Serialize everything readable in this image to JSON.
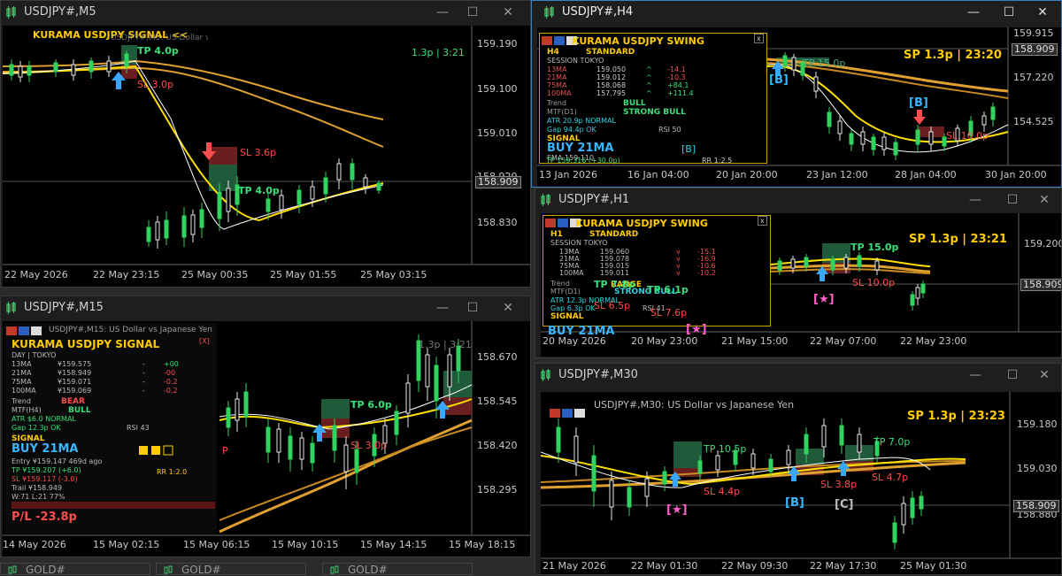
{
  "windows": {
    "m5": {
      "title": "USDJPY#,M5"
    },
    "m15": {
      "title": "USDJPY#,M15"
    },
    "h4": {
      "title": "USDJPY#,H4"
    },
    "h1": {
      "title": "USDJPY#,H1"
    },
    "m30": {
      "title": "USDJPY#,M30"
    }
  },
  "controls": {
    "minimize": "—",
    "maximize": "☐",
    "close": "✕"
  },
  "m5": {
    "header": "KURAMA USDJPY SIGNAL <<",
    "subheader": "USDJPY#,M5: US Dollar vs Japanese Yen",
    "spread": "1.3p | 3:21",
    "prices": [
      "159.190",
      "159.100",
      "159.010",
      "158.920",
      "158.830"
    ],
    "current": "158.909",
    "times": [
      "22 May 2026",
      "22 May 23:15",
      "25 May 00:35",
      "25 May 01:55",
      "25 May 03:15"
    ],
    "labels": {
      "tp1": "TP 4.0p",
      "sl1": "SL 3.0p",
      "sl2": "SL 3.6p",
      "tp2": "TP 4.0p"
    }
  },
  "m15": {
    "header": "KURAMA USDJPY SIGNAL",
    "subheader": "USDJPY#,M15: US Dollar vs Japanese Yen",
    "close_x": "[X]",
    "session": "DAY | TOKYO",
    "ma_rows": [
      {
        "name": "13MA",
        "val": "¥159.575",
        "sign": "-",
        "chg": "+00"
      },
      {
        "name": "21MA",
        "val": "¥158.949",
        "sign": "-",
        "chg": "-00"
      },
      {
        "name": "75MA",
        "val": "¥159.071",
        "sign": "-",
        "chg": "-0.2"
      },
      {
        "name": "100MA",
        "val": "¥159.069",
        "sign": "-",
        "chg": "-0.2"
      }
    ],
    "trend_label": "Trend",
    "trend_val": "BEAR",
    "mtf_label": "MTF(H4)",
    "mtf_val": "BULL",
    "atr": "ATR $6.0 NORMAL",
    "gap": "Gap 12.3p OK",
    "rsi": "RSI 43",
    "signal_label": "SIGNAL",
    "signal": "BUY 21MA",
    "entry": "Entry ¥159.147  469d ago",
    "tp": "TP ¥159.207 (+6.0)",
    "sl": "SL ¥159.117 (-3.0)",
    "trail": "Trail ¥158.949",
    "wl": "W:71 L:21 77%",
    "rr": "RR 1:2.0",
    "pl": "P/L -23.8p",
    "spread": "1.3p | 3:21",
    "prices": [
      "158.670",
      "158.545",
      "158.420",
      "158.295"
    ],
    "times": [
      "14 May 2026",
      "15 May 02:15",
      "15 May 06:15",
      "15 May 10:15",
      "15 May 14:15",
      "15 May 18:15"
    ],
    "labels": {
      "tp1": "TP 6.0p",
      "sl1": "SL 3.0p",
      "p": "P"
    }
  },
  "h4": {
    "header": "KURAMA USDJPY SWING",
    "close_x": "x",
    "tf": "H4",
    "mode": "STANDARD",
    "session": "SESSION TOKYO",
    "ma_rows": [
      {
        "name": "13MA",
        "val": "159.050",
        "dir": "^",
        "chg": "-14.1"
      },
      {
        "name": "21MA",
        "val": "159.012",
        "dir": "^",
        "chg": "-10.3"
      },
      {
        "name": "75MA",
        "val": "158.068",
        "dir": "^",
        "chg": "+84.1"
      },
      {
        "name": "100MA",
        "val": "157.795",
        "dir": "^",
        "chg": "+111.4"
      }
    ],
    "trend_label": "Trend",
    "trend_val": "BULL",
    "mtf_label": "MTF(D1)",
    "mtf_val": "STRONG BULL",
    "atr": "ATR 20.9p NORMAL",
    "gap": "Gap 94.4p OK",
    "rsi": "RSI 50",
    "signal_label": "SIGNAL",
    "signal": "BUY 21MA",
    "badge": "[B]",
    "ema": "EMA 159.110",
    "tp": "TP 159.316 (+30.0p)",
    "rr": "RR 1:2.5",
    "sp": "SP 1.3p | 23:20",
    "prices": [
      "159.915",
      "157.220",
      "154.525"
    ],
    "current": "158.909",
    "times": [
      "13 Jan 2026",
      "16 Jan 04:00",
      "20 Jan 20:00",
      "23 Jan 12:00",
      "28 Jan 04:00",
      "30 Jan 20:00"
    ],
    "labels": {
      "tp": "TP 15.0p",
      "sl": "SL 10.0p",
      "b1": "[B]",
      "b2": "[B]"
    }
  },
  "h1": {
    "header": "KURAMA USDJPY SWING",
    "close_x": "x",
    "tf": "H1",
    "mode": "STANDARD",
    "session": "SESSION TOKYO",
    "ma_rows": [
      {
        "name": "13MA",
        "val": "159.060",
        "dir": "v",
        "chg": "-15.1"
      },
      {
        "name": "21MA",
        "val": "159.078",
        "dir": "v",
        "chg": "-16.9"
      },
      {
        "name": "75MA",
        "val": "159.015",
        "dir": "v",
        "chg": "-10.6"
      },
      {
        "name": "100MA",
        "val": "159.011",
        "dir": "v",
        "chg": "-10.2"
      }
    ],
    "trend_label": "Trend",
    "range": "RANGE",
    "mtf_label": "MTF(D1)",
    "mtf_val": "STRONG BULL",
    "atr": "ATR 12.3p NORMAL",
    "gap": "Gap 6.3p OK",
    "rsi": "RSI 41",
    "signal_label": "SIGNAL",
    "signal": "BUY 21MA",
    "sp": "SP 1.3p | 23:21",
    "prices": [
      "159.200",
      "158.909"
    ],
    "current": "158.909",
    "times": [
      "20 May 2026",
      "20 May 23:00",
      "21 May 15:00",
      "22 May 07:00",
      "22 May 23:00"
    ],
    "labels": {
      "tp1": "TP 15.0p",
      "tp2": "TP 7.8p",
      "tp3": "TP 6.1p",
      "sl1": "SL 10.0p",
      "sl2": "SL 7.6p",
      "sl3": "SL 6.5p",
      "star1": "[★]",
      "star2": "[★]"
    }
  },
  "m30": {
    "header": "KURAMA USDJPY SWING",
    "subheader": "USDJPY#,M30: US Dollar vs Japanese Yen",
    "sp": "SP 1.3p | 23:23",
    "prices": [
      "159.180",
      "159.030",
      "158.880"
    ],
    "current": "158.909",
    "times": [
      "21 May 2026",
      "22 May 01:30",
      "22 May 09:30",
      "22 May 17:30",
      "25 May 01:30"
    ],
    "labels": {
      "tp1": "TP 10.5p",
      "tp2": "TP 7.0p",
      "sl1": "SL 4.4p",
      "sl2": "SL 3.8p",
      "sl3": "SL 4.7p",
      "star": "[★]",
      "b": "[B]",
      "c": "[C]"
    }
  },
  "bottom_tabs": [
    "GOLD#",
    "GOLD#",
    "GOLD#"
  ],
  "colors": {
    "bull": "#2fd35e",
    "bear": "#e8e8e8",
    "ma_yellow": "#ffe000",
    "ma_orange": "#e0a030",
    "ma_white": "#ffffff",
    "tp_box": "#1f5a3a",
    "sl_box": "#6a1f1f",
    "arrow_up": "#38a8ff",
    "arrow_down": "#ff4c4c",
    "accent": "#3b7fc4"
  },
  "icons": {
    "chart": "chart-icon",
    "minimize": "minimize-icon",
    "maximize": "maximize-icon",
    "close": "close-icon",
    "up": "arrow-up-icon",
    "down": "arrow-down-icon"
  }
}
